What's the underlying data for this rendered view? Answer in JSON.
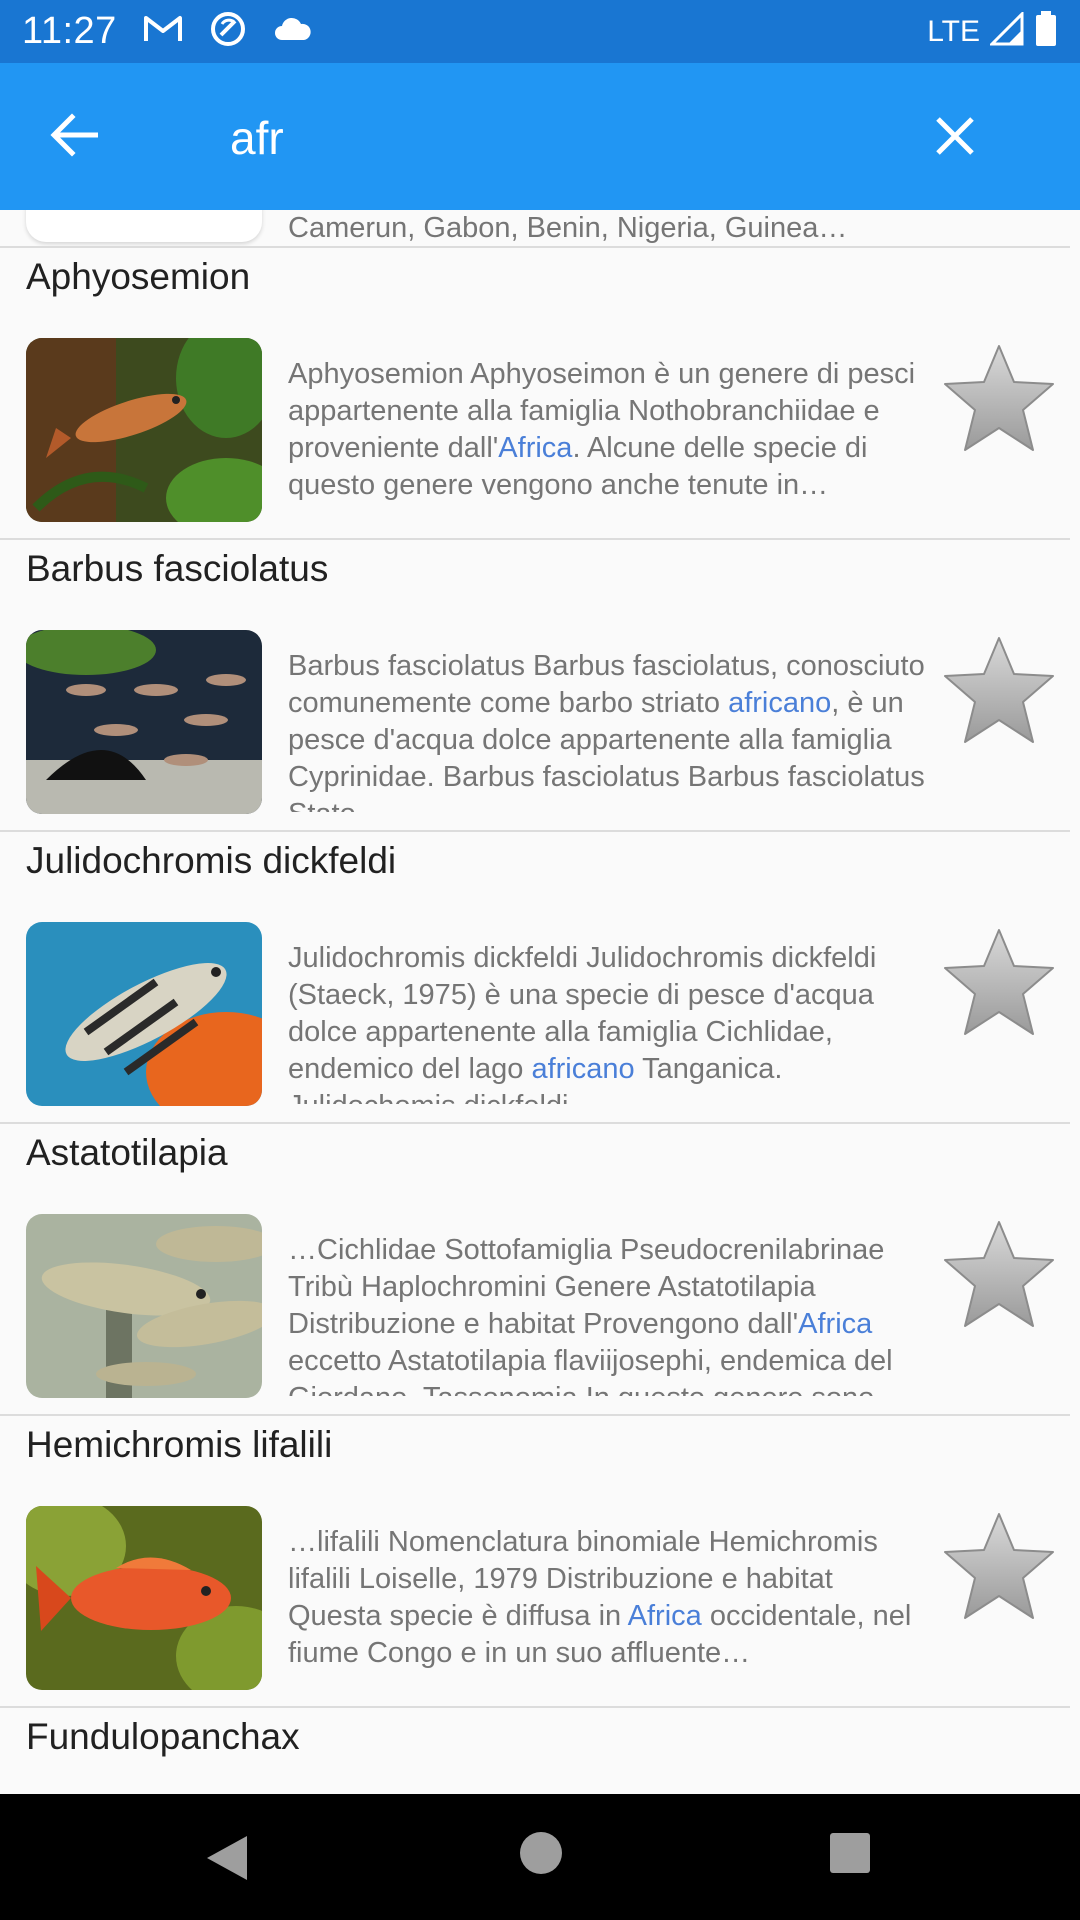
{
  "status_bar": {
    "time": "11:27",
    "network": "LTE",
    "icons": [
      "gmail-icon",
      "sync-icon",
      "cloud-icon",
      "signal-icon",
      "battery-icon"
    ]
  },
  "app_bar": {
    "search_value": "afr",
    "colors": {
      "status": "#1976d2",
      "toolbar": "#2196f3"
    }
  },
  "previous_item": {
    "snippet": "Camerun, Gabon, Benin, Nigeria, Guinea…"
  },
  "items": [
    {
      "title": "Aphyosemion",
      "desc": {
        "before": "Aphyosemion Aphyoseimon è un genere di pesci appartenente alla famiglia Nothobranchiidae e proveniente dall'",
        "match": "Africa",
        "after": ". Alcune delle specie di questo genere vengono anche tenute in…"
      }
    },
    {
      "title": "Barbus fasciolatus",
      "desc": {
        "before": "Barbus fasciolatus Barbus fasciolatus, conosciuto comunemente come barbo striato ",
        "match": "africano",
        "after": ", è un pesce d'acqua dolce appartenente alla famiglia Cyprinidae. Barbus fasciolatus Barbus fasciolatus Stato…"
      }
    },
    {
      "title": "Julidochromis dickfeldi",
      "desc": {
        "before": "Julidochromis dickfeldi Julidochromis dickfeldi (Staeck, 1975) è una specie di pesce d'acqua dolce appartenente alla famiglia Cichlidae, endemico del lago ",
        "match": "africano",
        "after": " Tanganica. Julidochomis dickfeldi…"
      }
    },
    {
      "title": "Astatotilapia",
      "desc": {
        "before": "…Cichlidae Sottofamiglia Pseudocrenilabrinae Tribù Haplochromini Genere Astatotilapia Distribuzione e habitat Provengono dall'",
        "match": "Africa",
        "after": " eccetto Astatotilapia flaviijosephi, endemica del Giordano. Tassonomia In questo genere sono riconosciute…"
      }
    },
    {
      "title": "Hemichromis lifalili",
      "desc": {
        "before": "…lifalili Nomenclatura binomiale Hemichromis lifalili Loiselle, 1979 Distribuzione e habitat Questa specie è diffusa in ",
        "match": "Africa",
        "after": " occidentale, nel fiume Congo e in un suo affluente…"
      }
    }
  ],
  "next_item": {
    "title": "Fundulopanchax"
  },
  "highlight_color": "#4a7fd8"
}
